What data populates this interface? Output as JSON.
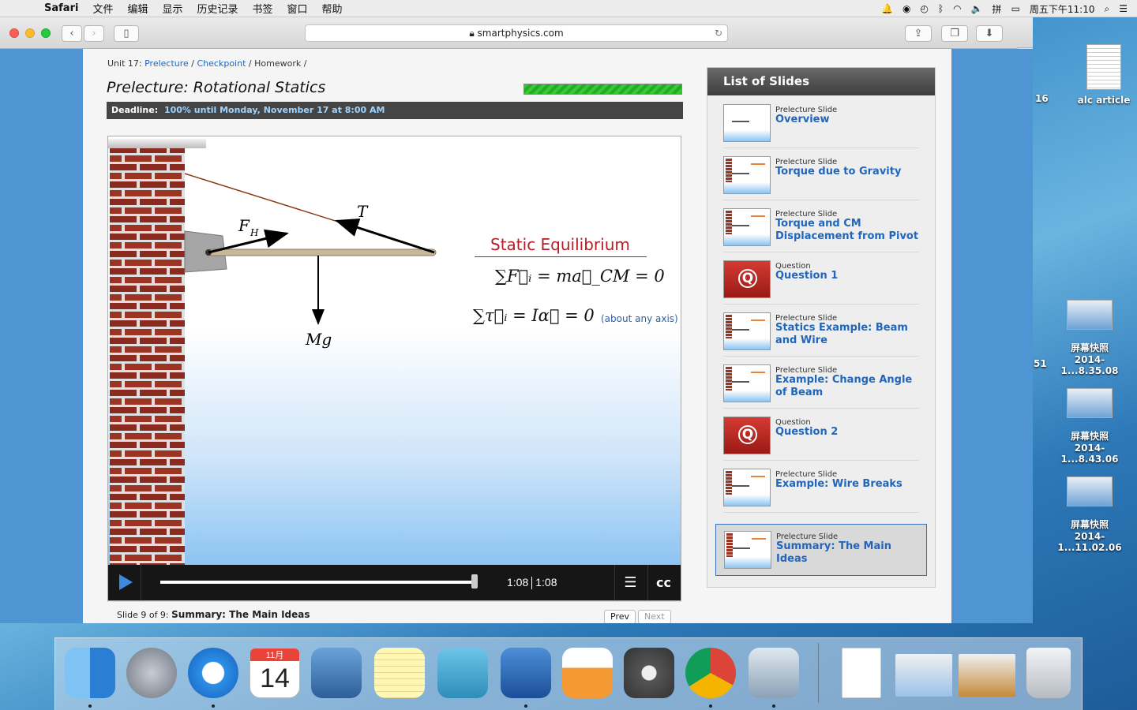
{
  "menubar": {
    "app": "Safari",
    "menus": [
      "文件",
      "编辑",
      "显示",
      "历史记录",
      "书签",
      "窗口",
      "帮助"
    ],
    "clock": "周五下午11:10"
  },
  "browser": {
    "url": "smartphysics.com"
  },
  "page": {
    "breadcrumb": {
      "unit": "Unit 17:",
      "link1": "Prelecture",
      "link2": "Checkpoint",
      "current": "Homework /"
    },
    "title": "Prelecture: Rotational Statics",
    "deadline_label": "Deadline:",
    "deadline_value": "100% until Monday, November 17 at 8:00 AM",
    "progress_fraction": 1.0
  },
  "slide": {
    "diagram_labels": {
      "force_hinge": "F",
      "force_hinge_sub": "H",
      "tension": "T",
      "weight": "Mg"
    },
    "equation_title": "Static Equilibrium",
    "equation1": "∑F⃗ᵢ = ma⃗_CM = 0",
    "equation2": "∑τ⃗ᵢ = Iα⃗ = 0",
    "equation_note": "(about any axis)",
    "player": {
      "elapsed": "1:08",
      "duration": "1:08",
      "progress_fraction": 1.0
    },
    "info_prefix": "Slide 9 of 9:",
    "info_title": "Summary: The Main Ideas",
    "prev_label": "Prev",
    "next_label": "Next"
  },
  "slide_list": {
    "header": "List of Slides",
    "items": [
      {
        "kind": "Prelecture Slide",
        "title": "Overview",
        "type": "slide"
      },
      {
        "kind": "Prelecture Slide",
        "title": "Torque due to Gravity",
        "type": "slide"
      },
      {
        "kind": "Prelecture Slide",
        "title": "Torque and CM Displacement from Pivot",
        "type": "slide"
      },
      {
        "kind": "Question",
        "title": "Question 1",
        "type": "question"
      },
      {
        "kind": "Prelecture Slide",
        "title": "Statics Example: Beam and Wire",
        "type": "slide"
      },
      {
        "kind": "Prelecture Slide",
        "title": "Example: Change Angle of Beam",
        "type": "slide"
      },
      {
        "kind": "Question",
        "title": "Question 2",
        "type": "question"
      },
      {
        "kind": "Prelecture Slide",
        "title": "Example: Wire Breaks",
        "type": "slide"
      },
      {
        "kind": "Prelecture Slide",
        "title": "Summary: The Main Ideas",
        "type": "slide"
      }
    ]
  },
  "desktop": {
    "icons": [
      {
        "label": "alc article"
      },
      {
        "label_line1": "屏幕快照",
        "label_line2": "2014-1...8.35.08"
      },
      {
        "label_line1": "屏幕快照",
        "label_line2": "2014-1...8.43.06"
      },
      {
        "label_line1": "屏幕快照",
        "label_line2": "2014-1...11.02.06"
      }
    ],
    "edge_labels": [
      "16",
      "51"
    ],
    "calendar_month": "11月",
    "calendar_day": "14"
  }
}
